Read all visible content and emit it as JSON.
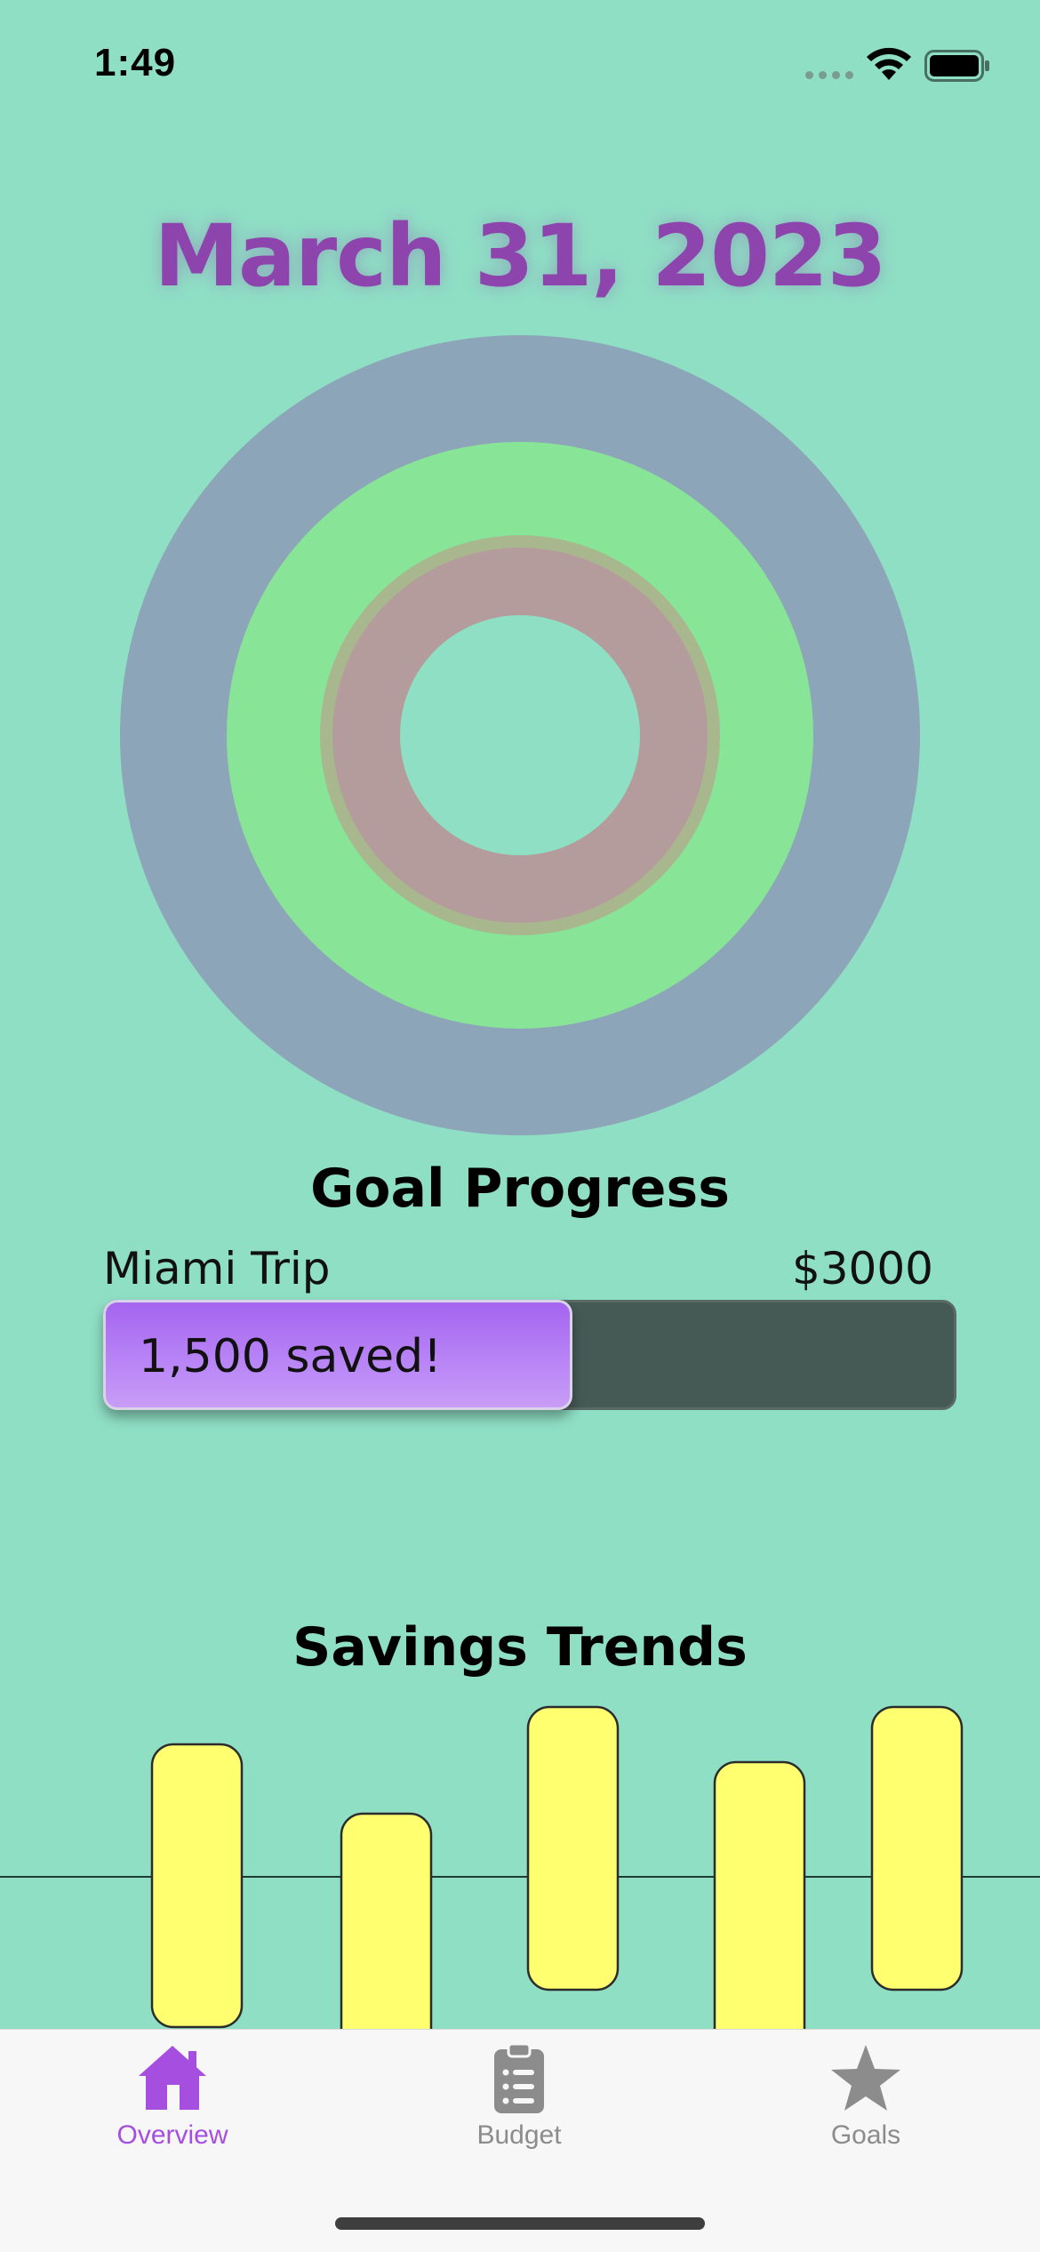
{
  "status_bar": {
    "time": "1:49"
  },
  "date_title": "March 31, 2023",
  "rings": [
    {
      "name": "outer",
      "color": "#8da5b8"
    },
    {
      "name": "middle",
      "color": "#88e597"
    },
    {
      "name": "inner",
      "color": "#b49c9c"
    }
  ],
  "goal_progress": {
    "title": "Goal Progress",
    "goal_name": "Miami Trip",
    "goal_amount": "$3000",
    "saved_label": "1,500 saved!",
    "fraction": 0.55
  },
  "savings_trends": {
    "title": "Savings Trends",
    "bar_color": "#ffff70"
  },
  "tabs": [
    {
      "label": "Overview",
      "icon": "house-icon",
      "active": true
    },
    {
      "label": "Budget",
      "icon": "clipboard-icon",
      "active": false
    },
    {
      "label": "Goals",
      "icon": "star-icon",
      "active": false
    }
  ],
  "colors": {
    "background": "#8fdfc5",
    "accent": "#a64ee0",
    "title": "#8e44ad",
    "inactive_tab": "#8c8c8c"
  }
}
